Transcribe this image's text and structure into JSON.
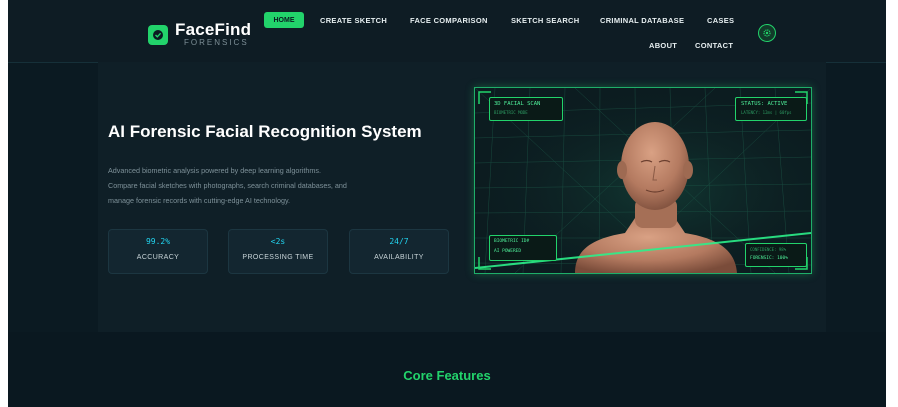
{
  "brand": {
    "title": "FaceFind",
    "subtitle": "FORENSICS"
  },
  "nav": {
    "home": "HOME",
    "links": [
      "CREATE SKETCH",
      "FACE COMPARISON",
      "SKETCH SEARCH",
      "CRIMINAL DATABASE",
      "CASES",
      "ABOUT",
      "CONTACT"
    ]
  },
  "hero": {
    "title": "AI Forensic Facial Recognition System",
    "desc_lines": [
      "Advanced biometric analysis powered by deep learning algorithms.",
      "Compare facial sketches with photographs, search criminal databases, and",
      "manage forensic records with cutting-edge AI technology."
    ],
    "stats": [
      {
        "value": "99.2%",
        "label": "ACCURACY"
      },
      {
        "value": "<2s",
        "label": "PROCESSING TIME"
      },
      {
        "value": "24/7",
        "label": "AVAILABILITY"
      }
    ]
  },
  "scan": {
    "top_left_title": "3D FACIAL SCAN",
    "top_left_sub": "BIOMETRIC MODE",
    "top_right_title": "STATUS: ACTIVE",
    "top_right_sub": "LATENCY: 12ms | 60fps",
    "bottom_left_1": "BIOMETRIC ID#",
    "bottom_left_2": "AI POWERED",
    "bottom_right_1": "CONFIDENCE: 98%",
    "bottom_right_2": "FORENSIC: 100%"
  },
  "sections": {
    "core_features": "Core Features"
  },
  "colors": {
    "accent": "#22d36b",
    "stat_value": "#22d3ee",
    "background": "#0b1a22"
  },
  "icons": {
    "logo": "shield-check-icon",
    "theme": "gear-icon"
  }
}
